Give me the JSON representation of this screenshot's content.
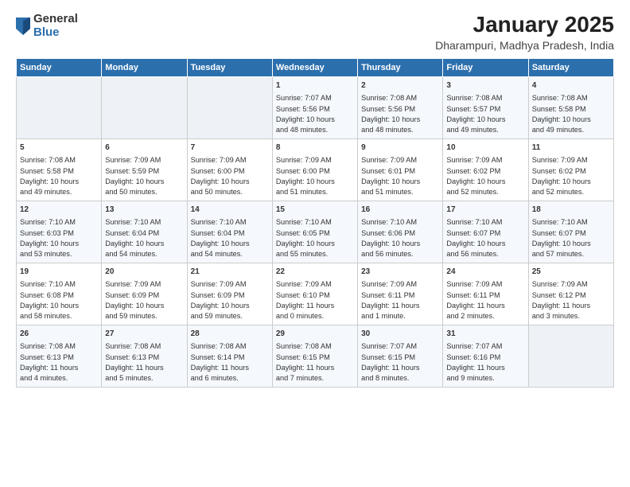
{
  "logo": {
    "general": "General",
    "blue": "Blue"
  },
  "title": "January 2025",
  "subtitle": "Dharampuri, Madhya Pradesh, India",
  "days_header": [
    "Sunday",
    "Monday",
    "Tuesday",
    "Wednesday",
    "Thursday",
    "Friday",
    "Saturday"
  ],
  "weeks": [
    [
      {
        "day": "",
        "content": ""
      },
      {
        "day": "",
        "content": ""
      },
      {
        "day": "",
        "content": ""
      },
      {
        "day": "1",
        "content": "Sunrise: 7:07 AM\nSunset: 5:56 PM\nDaylight: 10 hours\nand 48 minutes."
      },
      {
        "day": "2",
        "content": "Sunrise: 7:08 AM\nSunset: 5:56 PM\nDaylight: 10 hours\nand 48 minutes."
      },
      {
        "day": "3",
        "content": "Sunrise: 7:08 AM\nSunset: 5:57 PM\nDaylight: 10 hours\nand 49 minutes."
      },
      {
        "day": "4",
        "content": "Sunrise: 7:08 AM\nSunset: 5:58 PM\nDaylight: 10 hours\nand 49 minutes."
      }
    ],
    [
      {
        "day": "5",
        "content": "Sunrise: 7:08 AM\nSunset: 5:58 PM\nDaylight: 10 hours\nand 49 minutes."
      },
      {
        "day": "6",
        "content": "Sunrise: 7:09 AM\nSunset: 5:59 PM\nDaylight: 10 hours\nand 50 minutes."
      },
      {
        "day": "7",
        "content": "Sunrise: 7:09 AM\nSunset: 6:00 PM\nDaylight: 10 hours\nand 50 minutes."
      },
      {
        "day": "8",
        "content": "Sunrise: 7:09 AM\nSunset: 6:00 PM\nDaylight: 10 hours\nand 51 minutes."
      },
      {
        "day": "9",
        "content": "Sunrise: 7:09 AM\nSunset: 6:01 PM\nDaylight: 10 hours\nand 51 minutes."
      },
      {
        "day": "10",
        "content": "Sunrise: 7:09 AM\nSunset: 6:02 PM\nDaylight: 10 hours\nand 52 minutes."
      },
      {
        "day": "11",
        "content": "Sunrise: 7:09 AM\nSunset: 6:02 PM\nDaylight: 10 hours\nand 52 minutes."
      }
    ],
    [
      {
        "day": "12",
        "content": "Sunrise: 7:10 AM\nSunset: 6:03 PM\nDaylight: 10 hours\nand 53 minutes."
      },
      {
        "day": "13",
        "content": "Sunrise: 7:10 AM\nSunset: 6:04 PM\nDaylight: 10 hours\nand 54 minutes."
      },
      {
        "day": "14",
        "content": "Sunrise: 7:10 AM\nSunset: 6:04 PM\nDaylight: 10 hours\nand 54 minutes."
      },
      {
        "day": "15",
        "content": "Sunrise: 7:10 AM\nSunset: 6:05 PM\nDaylight: 10 hours\nand 55 minutes."
      },
      {
        "day": "16",
        "content": "Sunrise: 7:10 AM\nSunset: 6:06 PM\nDaylight: 10 hours\nand 56 minutes."
      },
      {
        "day": "17",
        "content": "Sunrise: 7:10 AM\nSunset: 6:07 PM\nDaylight: 10 hours\nand 56 minutes."
      },
      {
        "day": "18",
        "content": "Sunrise: 7:10 AM\nSunset: 6:07 PM\nDaylight: 10 hours\nand 57 minutes."
      }
    ],
    [
      {
        "day": "19",
        "content": "Sunrise: 7:10 AM\nSunset: 6:08 PM\nDaylight: 10 hours\nand 58 minutes."
      },
      {
        "day": "20",
        "content": "Sunrise: 7:09 AM\nSunset: 6:09 PM\nDaylight: 10 hours\nand 59 minutes."
      },
      {
        "day": "21",
        "content": "Sunrise: 7:09 AM\nSunset: 6:09 PM\nDaylight: 10 hours\nand 59 minutes."
      },
      {
        "day": "22",
        "content": "Sunrise: 7:09 AM\nSunset: 6:10 PM\nDaylight: 11 hours\nand 0 minutes."
      },
      {
        "day": "23",
        "content": "Sunrise: 7:09 AM\nSunset: 6:11 PM\nDaylight: 11 hours\nand 1 minute."
      },
      {
        "day": "24",
        "content": "Sunrise: 7:09 AM\nSunset: 6:11 PM\nDaylight: 11 hours\nand 2 minutes."
      },
      {
        "day": "25",
        "content": "Sunrise: 7:09 AM\nSunset: 6:12 PM\nDaylight: 11 hours\nand 3 minutes."
      }
    ],
    [
      {
        "day": "26",
        "content": "Sunrise: 7:08 AM\nSunset: 6:13 PM\nDaylight: 11 hours\nand 4 minutes."
      },
      {
        "day": "27",
        "content": "Sunrise: 7:08 AM\nSunset: 6:13 PM\nDaylight: 11 hours\nand 5 minutes."
      },
      {
        "day": "28",
        "content": "Sunrise: 7:08 AM\nSunset: 6:14 PM\nDaylight: 11 hours\nand 6 minutes."
      },
      {
        "day": "29",
        "content": "Sunrise: 7:08 AM\nSunset: 6:15 PM\nDaylight: 11 hours\nand 7 minutes."
      },
      {
        "day": "30",
        "content": "Sunrise: 7:07 AM\nSunset: 6:15 PM\nDaylight: 11 hours\nand 8 minutes."
      },
      {
        "day": "31",
        "content": "Sunrise: 7:07 AM\nSunset: 6:16 PM\nDaylight: 11 hours\nand 9 minutes."
      },
      {
        "day": "",
        "content": ""
      }
    ]
  ]
}
